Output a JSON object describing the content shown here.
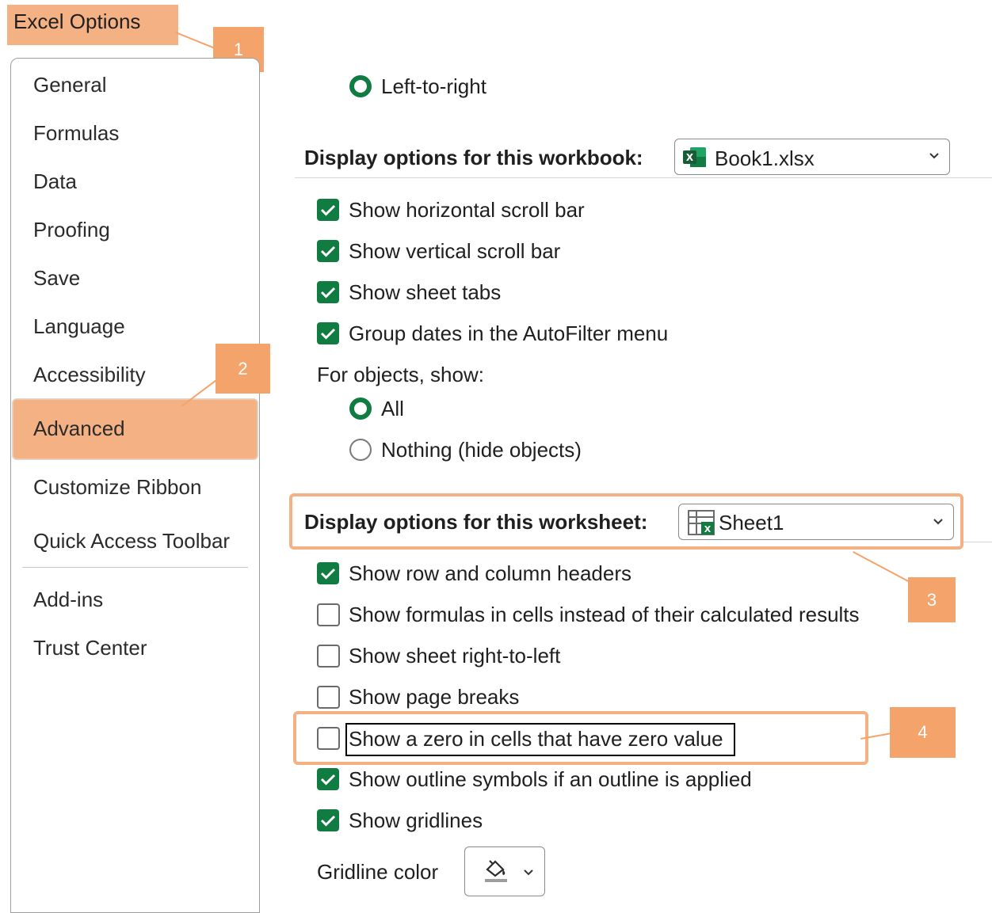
{
  "window": {
    "title": "Excel Options"
  },
  "callouts": [
    "1",
    "2",
    "3",
    "4"
  ],
  "sidebar": {
    "items": [
      "General",
      "Formulas",
      "Data",
      "Proofing",
      "Save",
      "Language",
      "Accessibility",
      "Advanced",
      "Customize Ribbon",
      "Quick Access Toolbar",
      "Add-ins",
      "Trust Center"
    ],
    "selected": "Advanced"
  },
  "direction": {
    "left_to_right": "Left-to-right"
  },
  "workbook": {
    "heading": "Display options for this workbook:",
    "selected": "Book1.xlsx",
    "options": [
      "Show horizontal scroll bar",
      "Show vertical scroll bar",
      "Show sheet tabs",
      "Group dates in the AutoFilter menu"
    ],
    "objects_label": "For objects, show:",
    "objects_all": "All",
    "objects_nothing": "Nothing (hide objects)"
  },
  "worksheet": {
    "heading": "Display options for this worksheet:",
    "selected": "Sheet1",
    "options": [
      "Show row and column headers",
      "Show formulas in cells instead of their calculated results",
      "Show sheet right-to-left",
      "Show page breaks",
      "Show a zero in cells that have zero value",
      "Show outline symbols if an outline is applied",
      "Show gridlines"
    ],
    "gridline_label": "Gridline color"
  },
  "colors": {
    "accent": "#107c41",
    "highlight": "#f4b183",
    "callout": "#f4a46a"
  },
  "icons": [
    "excel-file-icon",
    "sheet-icon",
    "chevron-down-icon",
    "paint-bucket-icon",
    "checkmark-icon"
  ]
}
